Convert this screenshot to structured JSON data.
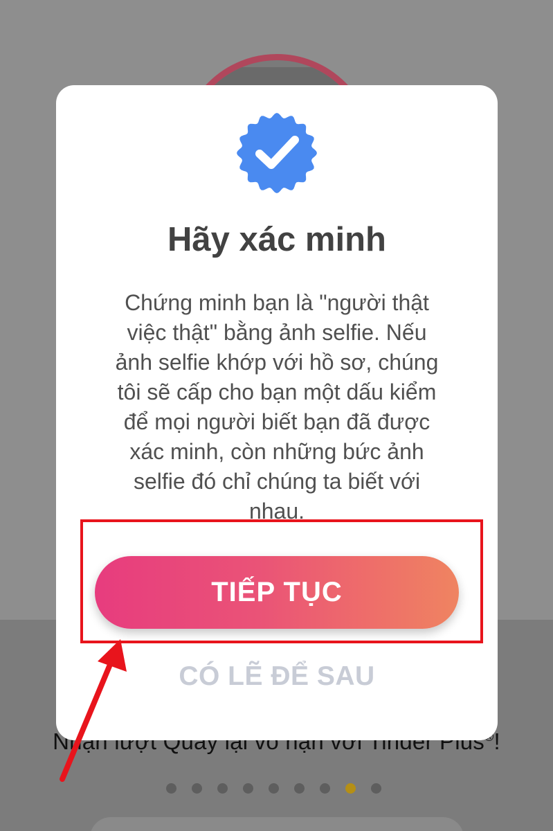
{
  "dialog": {
    "title": "Hãy xác minh",
    "description": "Chứng minh bạn là \"người thật\nviệc thật\" bằng ảnh selfie. Nếu\nảnh selfie khớp với hồ sơ, chúng\ntôi sẽ cấp cho bạn một dấu kiểm\nđể mọi người biết bạn đã được\nxác minh, còn những bức ảnh\nselfie đó chỉ chúng ta biết với\nnhau.",
    "continue_label": "TIẾP TỤC",
    "later_label": "CÓ LẼ ĐỂ SAU",
    "badge_icon": "verified-badge-icon"
  },
  "background": {
    "promo_text": "Nhận lượt Quay lại vô hạn với Tinder Plus",
    "promo_mark": "®",
    "promo_end": "!",
    "carousel": {
      "total": 9,
      "active_index": 7
    }
  },
  "colors": {
    "badge_blue": "#4a8af0",
    "cta_start": "#e73c7e",
    "cta_end": "#ef8461",
    "later_text": "#c8ccd6",
    "annotation_red": "#e8141c",
    "active_dot": "#b58f15"
  }
}
